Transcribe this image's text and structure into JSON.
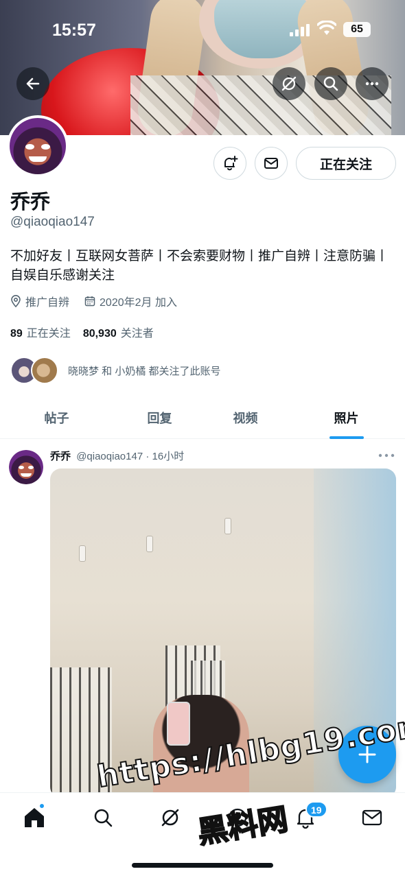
{
  "status_bar": {
    "time": "15:57",
    "battery": "65"
  },
  "profile": {
    "display_name": "乔乔",
    "handle": "@qiaoqiao147",
    "bio": "不加好友丨互联网女菩萨丨不会索要财物丨推广自辨丨注意防骗丨自娱自乐感谢关注",
    "location": "推广自辨",
    "joined": "2020年2月 加入",
    "following_count": "89",
    "following_label": "正在关注",
    "followers_count": "80,930",
    "followers_label": "关注者",
    "mutual_text": "晓晓梦 和 小奶橘 都关注了此账号",
    "follow_button": "正在关注"
  },
  "tabs": [
    {
      "label": "帖子",
      "active": false
    },
    {
      "label": "回复",
      "active": false
    },
    {
      "label": "视频",
      "active": false
    },
    {
      "label": "照片",
      "active": true
    }
  ],
  "post": {
    "author": "乔乔",
    "handle": "@qiaoqiao147",
    "time": "· 16小时"
  },
  "bottom_nav": {
    "items": [
      "home-icon",
      "search-icon",
      "grok-icon",
      "communities-icon",
      "notifications-icon",
      "messages-icon"
    ],
    "notifications_badge": "19"
  },
  "watermark": {
    "line1": "https://hlbg19.com",
    "line2": "黑料网"
  },
  "colors": {
    "accent": "#1d9bf0",
    "text": "#0f1419",
    "secondary": "#536471"
  }
}
